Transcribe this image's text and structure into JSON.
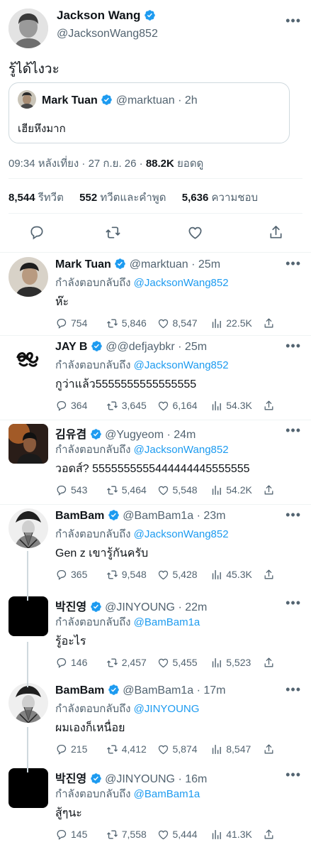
{
  "main_tweet": {
    "author_name": "Jackson Wang",
    "author_handle": "@JacksonWang852",
    "text": "รู้ได้ไงวะ",
    "quote": {
      "author_name": "Mark Tuan",
      "author_handle": "@marktuan",
      "time": "· 2h",
      "text": "เฮียหึงมาก"
    },
    "timestamp": "09:34 หลังเที่ยง · 27 ก.ย. 26 ·",
    "views_count": "88.2K",
    "views_label": "ยอดดู",
    "stats": {
      "retweets_count": "8,544",
      "retweets_label": "รีทวีต",
      "quotes_count": "552",
      "quotes_label": "ทวีตและคำพูด",
      "likes_count": "5,636",
      "likes_label": "ความชอบ"
    }
  },
  "replies": [
    {
      "name": "Mark Tuan",
      "handle": "@marktuan",
      "time": "· 25m",
      "reply_prefix": "กำลังตอบกลับถึง",
      "reply_to": "@JacksonWang852",
      "text": "ห๊ะ",
      "comments": "754",
      "retweets": "5,846",
      "likes": "8,547",
      "views": "22.5K"
    },
    {
      "name": "JAY B",
      "handle": "@@defjaybkr",
      "time": "· 25m",
      "reply_prefix": "กำลังตอบกลับถึง",
      "reply_to": "@JacksonWang852",
      "text": "กูว่าแล้ว5555555555555555",
      "comments": "364",
      "retweets": "3,645",
      "likes": "6,164",
      "views": "54.3K"
    },
    {
      "name": "김유겸",
      "handle": "@Yugyeom",
      "time": "· 24m",
      "reply_prefix": "กำลังตอบกลับถึง",
      "reply_to": "@JacksonWang852",
      "text": "วอดส์? 5555555555444444445555555",
      "comments": "543",
      "retweets": "5,464",
      "likes": "5,548",
      "views": "54.2K"
    },
    {
      "name": "BamBam",
      "handle": "@BamBam1a",
      "time": "· 23m",
      "reply_prefix": "กำลังตอบกลับถึง",
      "reply_to": "@JacksonWang852",
      "text": "Gen z เขารู้กันครับ",
      "comments": "365",
      "retweets": "9,548",
      "likes": "5,428",
      "views": "45.3K"
    },
    {
      "name": "박진영",
      "handle": "@JINYOUNG",
      "time": "· 22m",
      "reply_prefix": "กำลังตอบกลับถึง",
      "reply_to": "@BamBam1a",
      "text": "รู้อะไร",
      "comments": "146",
      "retweets": "2,457",
      "likes": "5,455",
      "views": "5,523"
    },
    {
      "name": "BamBam",
      "handle": "@BamBam1a",
      "time": "· 17m",
      "reply_prefix": "กำลังตอบกลับถึง",
      "reply_to": "@JINYOUNG",
      "text": "ผมเองก็เหนื่อย",
      "comments": "215",
      "retweets": "4,412",
      "likes": "5,874",
      "views": "8,547"
    },
    {
      "name": "박진영",
      "handle": "@JINYOUNG",
      "time": "· 16m",
      "reply_prefix": "กำลังตอบกลับถึง",
      "reply_to": "@BamBam1a",
      "text": "สู้ๆนะ",
      "comments": "145",
      "retweets": "7,558",
      "likes": "5,444",
      "views": "41.3K"
    }
  ],
  "icons": {
    "verified": "verified-badge-icon",
    "reply": "reply-icon",
    "retweet": "retweet-icon",
    "like": "heart-icon",
    "views": "views-bar-chart-icon",
    "share": "share-icon",
    "more": "more-dots-icon"
  },
  "colors": {
    "accent": "#1d9bf0",
    "muted": "#536471",
    "text": "#0f1419",
    "divider": "#eff3f4"
  }
}
